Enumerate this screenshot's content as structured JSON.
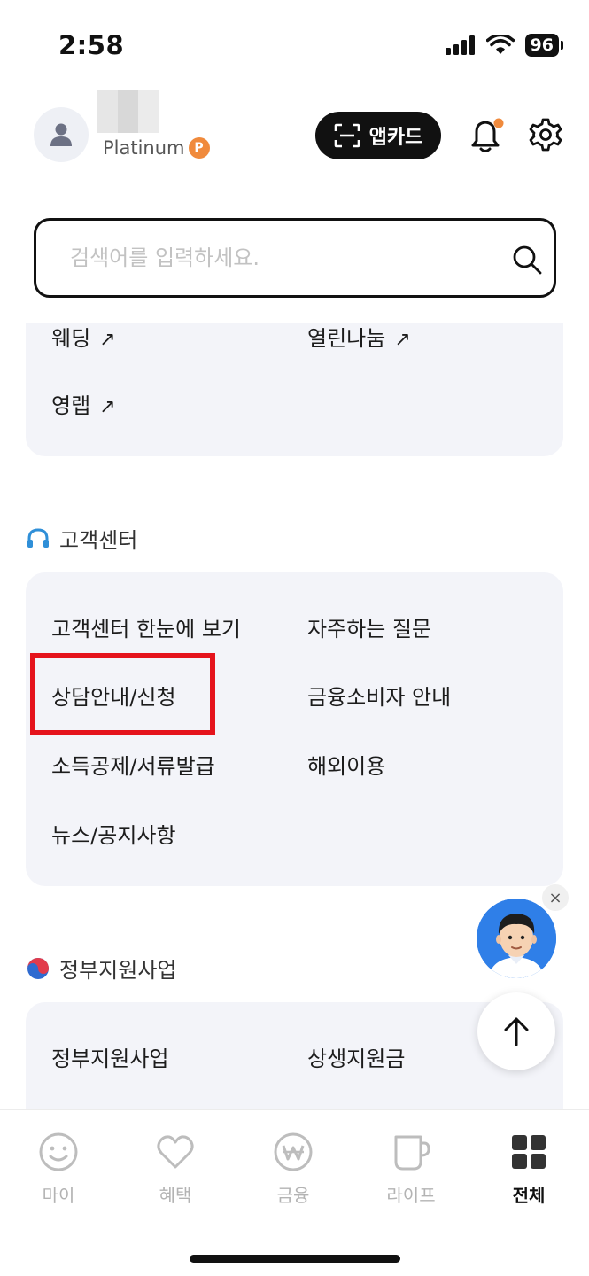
{
  "status_bar": {
    "time": "2:58",
    "battery": "96"
  },
  "header": {
    "grade": "Platinum",
    "grade_badge": "P",
    "appcard_label": "앱카드"
  },
  "search": {
    "placeholder": "검색어를 입력하세요."
  },
  "top_card": {
    "items": [
      {
        "label": "웨딩",
        "external": "↗"
      },
      {
        "label": "열린나눔",
        "external": "↗"
      },
      {
        "label": "영랩",
        "external": "↗"
      }
    ]
  },
  "customer_center": {
    "title": "고객센터",
    "items": [
      {
        "label": "고객센터 한눈에 보기"
      },
      {
        "label": "자주하는 질문"
      },
      {
        "label": "상담안내/신청"
      },
      {
        "label": "금융소비자 안내"
      },
      {
        "label": "소득공제/서류발급"
      },
      {
        "label": "해외이용"
      },
      {
        "label": "뉴스/공지사항"
      }
    ]
  },
  "gov_support": {
    "title": "정부지원사업",
    "items": [
      {
        "label": "정부지원사업"
      },
      {
        "label": "상생지원금"
      }
    ]
  },
  "floating": {
    "close_symbol": "×"
  },
  "bottom_nav": {
    "items": [
      {
        "label": "마이",
        "icon": "smile-icon"
      },
      {
        "label": "혜택",
        "icon": "heart-icon"
      },
      {
        "label": "금융",
        "icon": "won-icon"
      },
      {
        "label": "라이프",
        "icon": "cup-icon"
      },
      {
        "label": "전체",
        "icon": "grid-icon",
        "active": true
      }
    ]
  },
  "colors": {
    "highlight": "#e5131c",
    "card_bg": "#f3f4f9",
    "grade_badge": "#f08a3c",
    "notification_dot": "#f08a3c",
    "chatbot_bg": "#2f7fe8"
  }
}
